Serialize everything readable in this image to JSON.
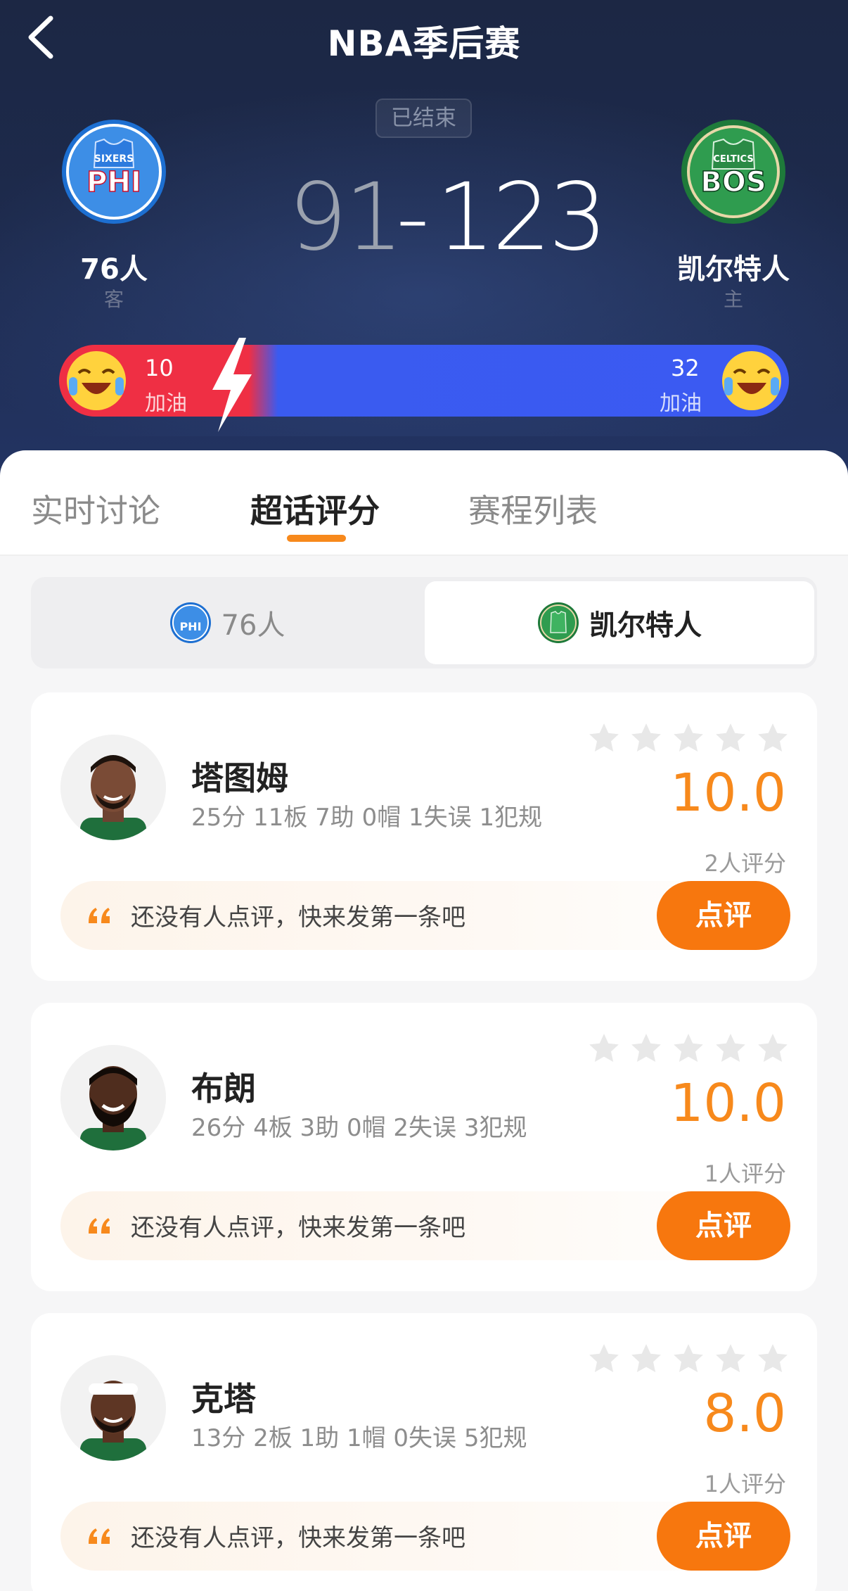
{
  "header": {
    "title": "NBA季后赛",
    "status": "已结束",
    "away": {
      "abbr": "PHI",
      "tag": "SIXERS",
      "name": "76人",
      "role": "客",
      "score": "91",
      "color": "#1d6fd1"
    },
    "home": {
      "abbr": "BOS",
      "tag": "CELTICS",
      "name": "凯尔特人",
      "role": "主",
      "score": "123",
      "color": "#1e7a3a"
    },
    "score_separator": "-"
  },
  "support": {
    "away": {
      "count": "10",
      "label": "加油",
      "color": "#ef2f44"
    },
    "home": {
      "count": "32",
      "label": "加油",
      "color": "#3b5af2"
    }
  },
  "tabs": [
    {
      "label": "实时讨论",
      "active": false
    },
    {
      "label": "超话评分",
      "active": true
    },
    {
      "label": "赛程列表",
      "active": false
    }
  ],
  "team_switch": {
    "away_label": "76人",
    "home_label": "凯尔特人",
    "selected": "home"
  },
  "players": [
    {
      "name": "塔图姆",
      "stats": "25分 11板 7助 0帽 1失误 1犯规",
      "score": "10.0",
      "rating_count": "2人评分",
      "comment_placeholder": "还没有人点评，快来发第一条吧",
      "button": "点评",
      "avatar_icon": "player-avatar-tatum"
    },
    {
      "name": "布朗",
      "stats": "26分 4板 3助 0帽 2失误 3犯规",
      "score": "10.0",
      "rating_count": "1人评分",
      "comment_placeholder": "还没有人点评，快来发第一条吧",
      "button": "点评",
      "avatar_icon": "player-avatar-brown"
    },
    {
      "name": "克塔",
      "stats": "13分 2板 1助 1帽 0失误 5犯规",
      "score": "8.0",
      "rating_count": "1人评分",
      "comment_placeholder": "还没有人点评，快来发第一条吧",
      "button": "点评",
      "avatar_icon": "player-avatar-kornet"
    }
  ],
  "colors": {
    "accent": "#f7891c",
    "button": "#f7770e"
  }
}
